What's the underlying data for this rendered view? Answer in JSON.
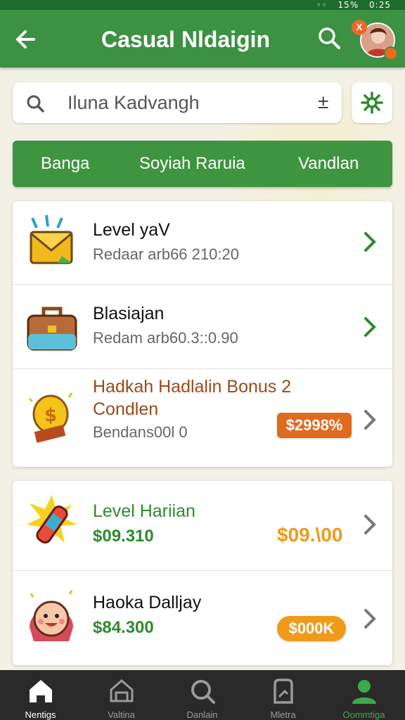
{
  "status_bar": {
    "battery": "15%",
    "time": "0:25"
  },
  "app_bar": {
    "title": "Casual Nldaigin",
    "avatar_badge": "X"
  },
  "search": {
    "value": "Iluna Kadvangh",
    "action_symbol": "±"
  },
  "tabs": [
    {
      "label": "Banga"
    },
    {
      "label": "Soyiah Raruia"
    },
    {
      "label": "Vandlan"
    }
  ],
  "list_group_1": [
    {
      "icon": "envelope-icon",
      "title": "Level yaV",
      "subtitle": "Redaar arb66 210:20"
    },
    {
      "icon": "briefcase-icon",
      "title": "Blasiajan",
      "subtitle": "Redam arb60.3::0.90"
    },
    {
      "icon": "money-bag-icon",
      "title": "Hadkah Hadlalin Bonus 2",
      "title_line2": "Condlen",
      "subtitle": "Bendans00l 0",
      "badge": "$2998%"
    }
  ],
  "list_group_2": [
    {
      "icon": "firecracker-icon",
      "title": "Level Hariian",
      "value": "$09.310",
      "amount": "$09.\\00"
    },
    {
      "icon": "character-face-icon",
      "title": "Haoka Dalljay",
      "value": "$84.300",
      "badge": "$000K"
    }
  ],
  "bottom_nav": [
    {
      "label": "Nentigs",
      "icon": "home-icon",
      "active": false
    },
    {
      "label": "Valtina",
      "icon": "store-icon",
      "active": false
    },
    {
      "label": "Danlain",
      "icon": "search-icon",
      "active": false
    },
    {
      "label": "Mletra",
      "icon": "document-icon",
      "active": false
    },
    {
      "label": "Oommtiga",
      "icon": "person-icon",
      "active": true
    }
  ],
  "colors": {
    "primary": "#3c9142",
    "accent": "#e86a2c",
    "gold": "#f09a1a",
    "nav_bg": "#2a2a2a"
  }
}
